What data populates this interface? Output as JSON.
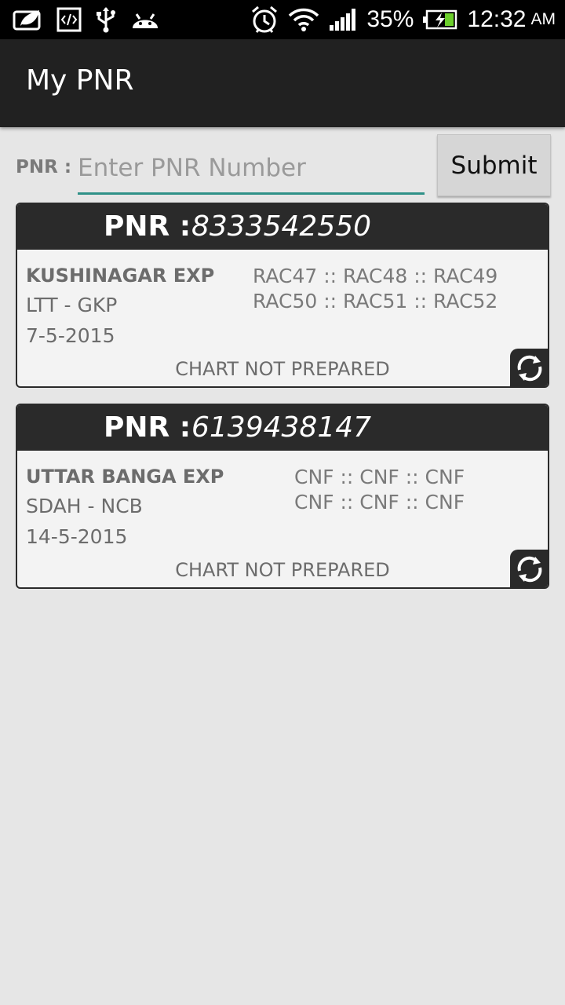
{
  "status_bar": {
    "battery": "35%",
    "time": "12:32",
    "ampm": "AM"
  },
  "app_bar": {
    "title": "My PNR"
  },
  "search": {
    "label": "PNR :",
    "placeholder": "Enter PNR Number",
    "value": "",
    "submit_label": "Submit"
  },
  "colors": {
    "accent": "#2f9188",
    "header": "#212121",
    "card_header": "#2a2a2a",
    "background": "#e6e6e6"
  },
  "cards": [
    {
      "pnr_label": "PNR :",
      "pnr_number": "8333542550",
      "train": "KUSHINAGAR EXP",
      "route": "LTT - GKP",
      "date": "7-5-2015",
      "seats_line1": "RAC47 :: RAC48 :: RAC49",
      "seats_line2": "RAC50 :: RAC51 :: RAC52",
      "chart_status": "CHART NOT PREPARED",
      "refresh_icon": "refresh-icon"
    },
    {
      "pnr_label": "PNR :",
      "pnr_number": "6139438147",
      "train": "UTTAR BANGA EXP",
      "route": "SDAH - NCB",
      "date": "14-5-2015",
      "seats_line1": "CNF :: CNF :: CNF",
      "seats_line2": "CNF :: CNF :: CNF",
      "chart_status": "CHART NOT PREPARED",
      "refresh_icon": "refresh-icon"
    }
  ]
}
